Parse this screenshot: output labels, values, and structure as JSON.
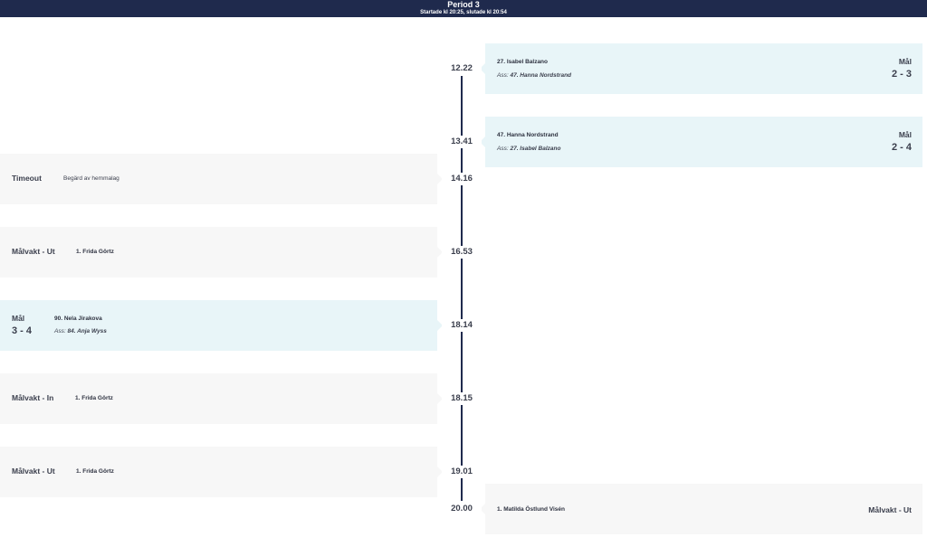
{
  "header": {
    "title": "Period 3",
    "subtitle": "Startade kl 20:25, slutade kl 20:54"
  },
  "events": {
    "e1": {
      "time": "12.22",
      "player": "27. Isabel Balzano",
      "assist_prefix": "Ass:",
      "assist": "47. Hanna Nordstrand",
      "label": "Mål",
      "score": "2 - 3"
    },
    "e2": {
      "time": "13.41",
      "player": "47. Hanna Nordstrand",
      "assist_prefix": "Ass:",
      "assist": "27. Isabel Balzano",
      "label": "Mål",
      "score": "2 - 4"
    },
    "e3": {
      "time": "14.16",
      "type": "Timeout",
      "detail": "Begärd av hemmalag"
    },
    "e4": {
      "time": "16.53",
      "type": "Målvakt - Ut",
      "player": "1. Frida Görtz"
    },
    "e5": {
      "time": "18.14",
      "label": "Mål",
      "score": "3 - 4",
      "player": "90. Nela Jirakova",
      "assist_prefix": "Ass:",
      "assist": "84. Anja Wyss"
    },
    "e6": {
      "time": "18.15",
      "type": "Målvakt - In",
      "player": "1. Frida Görtz"
    },
    "e7": {
      "time": "19.01",
      "type": "Målvakt - Ut",
      "player": "1. Frida Görtz"
    },
    "e8": {
      "time": "20.00",
      "type": "Målvakt - Ut",
      "player": "1. Matilda Östlund Visén"
    }
  },
  "colors": {
    "header_bg": "#1f2a4d",
    "goal_card_bg": "#e8f5f8",
    "event_card_bg": "#f7f7f7",
    "timeline": "#1f2a4d"
  }
}
